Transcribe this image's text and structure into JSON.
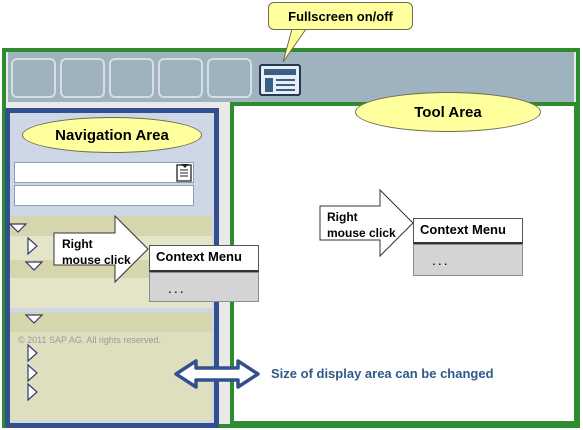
{
  "callout": {
    "label": "Fullscreen on/off"
  },
  "navigation": {
    "title": "Navigation Area"
  },
  "tool": {
    "title": "Tool Area"
  },
  "context_menu": {
    "title": "Context Menu",
    "body": "..."
  },
  "right_click": {
    "line1": "Right",
    "line2": "mouse click"
  },
  "copyright": "© 2011 SAP AG. All rights reserved.",
  "resize": {
    "label": "Size of display area can be changed"
  },
  "icons": [
    "fullscreen-icon",
    "tree-expand-icon",
    "tree-collapse-icon",
    "resize-double-arrow-icon",
    "value-help-icon"
  ],
  "colors": {
    "frame_green": "#2e8b2e",
    "nav_blue": "#32508d",
    "callout_yellow": "#ffff9e",
    "toolbar": "#9eb3bd"
  }
}
